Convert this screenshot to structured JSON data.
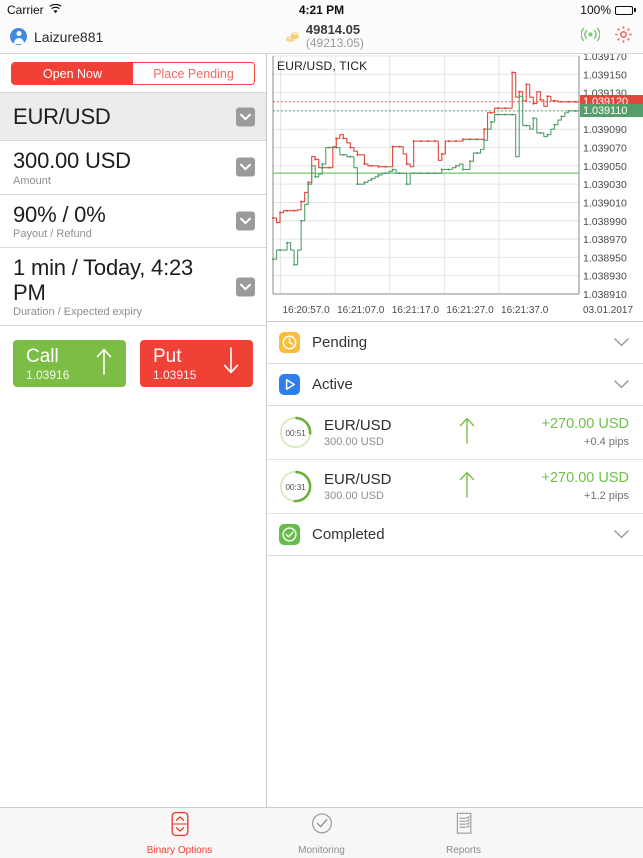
{
  "status_bar": {
    "carrier": "Carrier",
    "wifi_icon": "wifi-icon",
    "time": "4:21 PM",
    "battery_percent": "100%",
    "battery_icon": "battery-full-icon"
  },
  "account_bar": {
    "avatar_icon": "user-avatar-icon",
    "username": "Laizure881",
    "coins_icon": "coin-stack-icon",
    "balance": "49814.05",
    "equity": "(49213.05)",
    "connection_icon": "signal-connection-icon",
    "settings_icon": "gear-icon"
  },
  "order_panel": {
    "mode_tabs": [
      {
        "label": "Open Now",
        "selected": true
      },
      {
        "label": "Place Pending",
        "selected": false
      }
    ],
    "params": [
      {
        "name": "symbol",
        "title": "EUR/USD",
        "sub": "",
        "selected": true
      },
      {
        "name": "amount",
        "title": "300.00 USD",
        "sub": "Amount",
        "selected": false
      },
      {
        "name": "payout",
        "title": "90% / 0%",
        "sub": "Payout / Refund",
        "selected": false
      },
      {
        "name": "duration",
        "title": "1 min / Today, 4:23 PM",
        "sub": "Duration / Expected expiry",
        "selected": false
      }
    ],
    "call": {
      "label": "Call",
      "price": "1.03916",
      "arrow": "arrow-up-icon",
      "color": "#7bbd45"
    },
    "put": {
      "label": "Put",
      "price": "1.03915",
      "arrow": "arrow-down-icon",
      "color": "#ef4136"
    }
  },
  "chart_data": {
    "type": "line",
    "title": "EUR/USD, TICK",
    "xlabel": "",
    "ylabel": "",
    "grid": true,
    "date_label": "03.01.2017",
    "ylim": [
      1.03891,
      1.03917
    ],
    "y_ticks": [
      "1.039170",
      "1.039150",
      "1.039130",
      "1.039110",
      "1.039090",
      "1.039070",
      "1.039050",
      "1.039030",
      "1.039010",
      "1.038990",
      "1.038970",
      "1.038950",
      "1.038930",
      "1.038910"
    ],
    "x_ticks": [
      "16:20:57.0",
      "16:21:07.0",
      "16:21:17.0",
      "16:21:27.0",
      "16:21:37.0"
    ],
    "current_ask": "1.039120",
    "current_bid": "1.039110",
    "ask_color": "#e0483d",
    "bid_color": "#549e6a",
    "entry_line_value": 1.039042,
    "entry_line_color": "#7ec97e",
    "series": [
      {
        "name": "Ask",
        "color": "#e0483d",
        "values": [
          1.038993,
          1.038988,
          1.038999,
          1.039001,
          1.039001,
          1.039001,
          1.039001,
          1.039002,
          1.039011,
          1.039021,
          1.039032,
          1.03906,
          1.039057,
          1.039048,
          1.039048,
          1.039048,
          1.039048,
          1.039071,
          1.03908,
          1.039084,
          1.03908,
          1.039075,
          1.03907,
          1.039066,
          1.039062,
          1.039062,
          1.039052,
          1.03905,
          1.03905,
          1.03905,
          1.039049,
          1.039049,
          1.039049,
          1.039049,
          1.039071,
          1.039071,
          1.039071,
          1.039063,
          1.039052,
          1.039049,
          1.039077,
          1.039077,
          1.039077,
          1.039077,
          1.039077,
          1.039077,
          1.039077,
          1.039056,
          1.039063,
          1.039077,
          1.039077,
          1.039077,
          1.039077,
          1.039077,
          1.039079,
          1.039079,
          1.039079,
          1.039079,
          1.039079,
          1.039079,
          1.03909,
          1.039108,
          1.039108,
          1.039113,
          1.039113,
          1.039113,
          1.039113,
          1.039113,
          1.039152,
          1.039125,
          1.039131,
          1.039121,
          1.039139,
          1.039125,
          1.039118,
          1.039131,
          1.039122,
          1.039115,
          1.039126,
          1.039121,
          1.039121,
          1.03912,
          1.03912,
          1.03912,
          1.03912,
          1.03912,
          1.03912,
          1.03912
        ]
      },
      {
        "name": "Bid",
        "color": "#549e6a",
        "values": [
          1.038948,
          1.038958,
          1.038958,
          1.038958,
          1.038966,
          1.038958,
          1.038942,
          1.038958,
          1.03899,
          1.039008,
          1.03903,
          1.03905,
          1.039038,
          1.039041,
          1.039052,
          1.03907,
          1.03907,
          1.03907,
          1.03907,
          1.039062,
          1.039062,
          1.03906,
          1.03906,
          1.039048,
          1.03903,
          1.03903,
          1.039032,
          1.039034,
          1.039036,
          1.039038,
          1.03904,
          1.039042,
          1.039042,
          1.039044,
          1.039046,
          1.039042,
          1.039042,
          1.039042,
          1.03903,
          1.039042,
          1.039042,
          1.039042,
          1.039042,
          1.039042,
          1.039042,
          1.039042,
          1.039042,
          1.039042,
          1.039046,
          1.039046,
          1.039046,
          1.039048,
          1.03905,
          1.039052,
          1.039046,
          1.039046,
          1.039055,
          1.039064,
          1.039064,
          1.039068,
          1.039078,
          1.03909,
          1.039098,
          1.039106,
          1.039106,
          1.039106,
          1.039106,
          1.039106,
          1.039106,
          1.03906,
          1.039126,
          1.039094,
          1.039094,
          1.03909,
          1.039102,
          1.039086,
          1.039086,
          1.039082,
          1.039084,
          1.03909,
          1.039095,
          1.0391,
          1.039104,
          1.039108,
          1.03911,
          1.03911,
          1.03911,
          1.03911
        ]
      }
    ]
  },
  "trade_sections": [
    {
      "name": "pending",
      "icon": "clock-icon",
      "label": "Pending",
      "chevron": "chevron-down-icon",
      "color": "#f9bd3b"
    },
    {
      "name": "active",
      "icon": "play-icon",
      "label": "Active",
      "chevron": "chevron-down-icon",
      "color": "#2d7ff0"
    },
    {
      "name": "completed",
      "icon": "check-circle-icon",
      "label": "Completed",
      "chevron": "chevron-down-icon",
      "color": "#67bd4c"
    }
  ],
  "active_trades": [
    {
      "timer": "00:51",
      "timer_progress": 0.27,
      "symbol": "EUR/USD",
      "amount": "300.00 USD",
      "direction": "arrow-up-icon",
      "profit": "+270.00 USD",
      "pips": "+0.4 pips"
    },
    {
      "timer": "00:31",
      "timer_progress": 0.52,
      "symbol": "EUR/USD",
      "amount": "300.00 USD",
      "direction": "arrow-up-icon",
      "profit": "+270.00 USD",
      "pips": "+1.2 pips"
    }
  ],
  "tab_bar": [
    {
      "name": "binary-options",
      "icon": "updown-arrows-icon",
      "label": "Binary Options",
      "selected": true
    },
    {
      "name": "monitoring",
      "icon": "check-circle-icon",
      "label": "Monitoring",
      "selected": false
    },
    {
      "name": "reports",
      "icon": "report-list-icon",
      "label": "Reports",
      "selected": false
    }
  ],
  "colors": {
    "accent": "#ef4136",
    "call_green": "#7bbd45",
    "put_red": "#ef4136",
    "profit_green": "#6fc14a"
  }
}
